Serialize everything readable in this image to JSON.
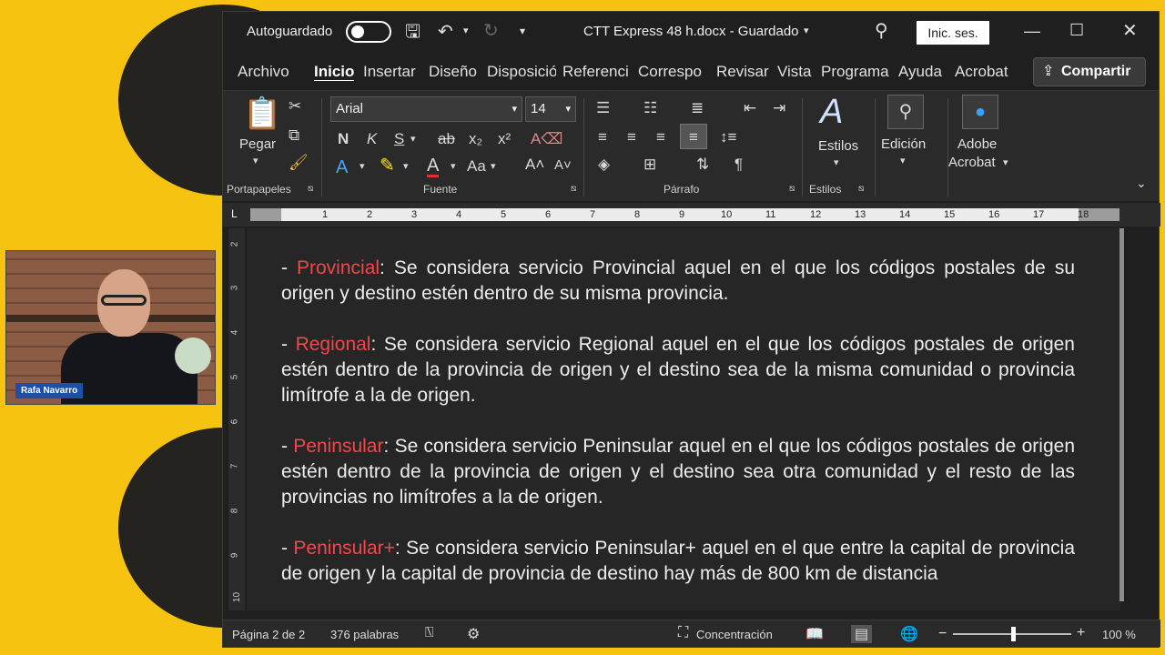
{
  "titlebar": {
    "autosave_label": "Autoguardado",
    "doc_title": "CTT Express 48 h.docx  -  Guardado",
    "signin_label": "Inic. ses."
  },
  "tabs": [
    "Archivo",
    "Inicio",
    "Insertar",
    "Diseño",
    "Disposició",
    "Referenci",
    "Correspo",
    "Revisar",
    "Vista",
    "Programa",
    "Ayuda",
    "Acrobat"
  ],
  "share_label": "Compartir",
  "ribbon": {
    "paste_label": "Pegar",
    "font_name": "Arial",
    "font_size": "14",
    "styles_label": "Estilos",
    "edit_label": "Edición",
    "adobe_label_1": "Adobe",
    "adobe_label_2": "Acrobat",
    "groups": {
      "clipboard": "Portapapeles",
      "font": "Fuente",
      "paragraph": "Párrafo",
      "styles": "Estilos"
    },
    "format_glyphs": {
      "bold": "N",
      "italic": "K",
      "underline": "S",
      "strike": "ab",
      "sub": "x₂",
      "sup": "x²",
      "case": "Aa",
      "pilcrow": "¶"
    }
  },
  "ruler_numbers": [
    "1",
    "2",
    "3",
    "4",
    "5",
    "6",
    "7",
    "8",
    "9",
    "10",
    "11",
    "12",
    "13",
    "14",
    "15",
    "16",
    "17",
    "18"
  ],
  "vruler_numbers": [
    "2",
    "3",
    "4",
    "5",
    "6",
    "7",
    "8",
    "9",
    "10"
  ],
  "document": {
    "paragraphs": [
      {
        "keyword": "Provincial",
        "text": ": Se considera servicio Provincial aquel en el que los códigos postales de su origen y destino estén dentro de su misma provincia."
      },
      {
        "keyword": "Regional",
        "text": ": Se considera servicio Regional aquel en el que los códigos postales de origen estén dentro de la provincia de origen y el destino sea de la misma comunidad o provincia limítrofe a la de origen."
      },
      {
        "keyword": "Peninsular",
        "text": ": Se considera servicio Peninsular aquel en el que los códigos postales de origen estén dentro de la provincia de origen y el destino sea otra comunidad y el resto de las provincias no limítrofes a la de origen."
      },
      {
        "keyword": "Peninsular+",
        "text": ": Se considera servicio Peninsular+ aquel en el que entre la capital de provincia de origen y la capital de provincia de destino hay más de 800 km de distancia"
      }
    ]
  },
  "status": {
    "page": "Página 2 de 2",
    "words": "376 palabras",
    "focus": "Concentración",
    "zoom": "100 %"
  },
  "webcam": {
    "name_tag": "Rafa Navarro"
  },
  "colors": {
    "background": "#f6c410",
    "keyword": "#f04848",
    "window": "#1f1f1f"
  }
}
